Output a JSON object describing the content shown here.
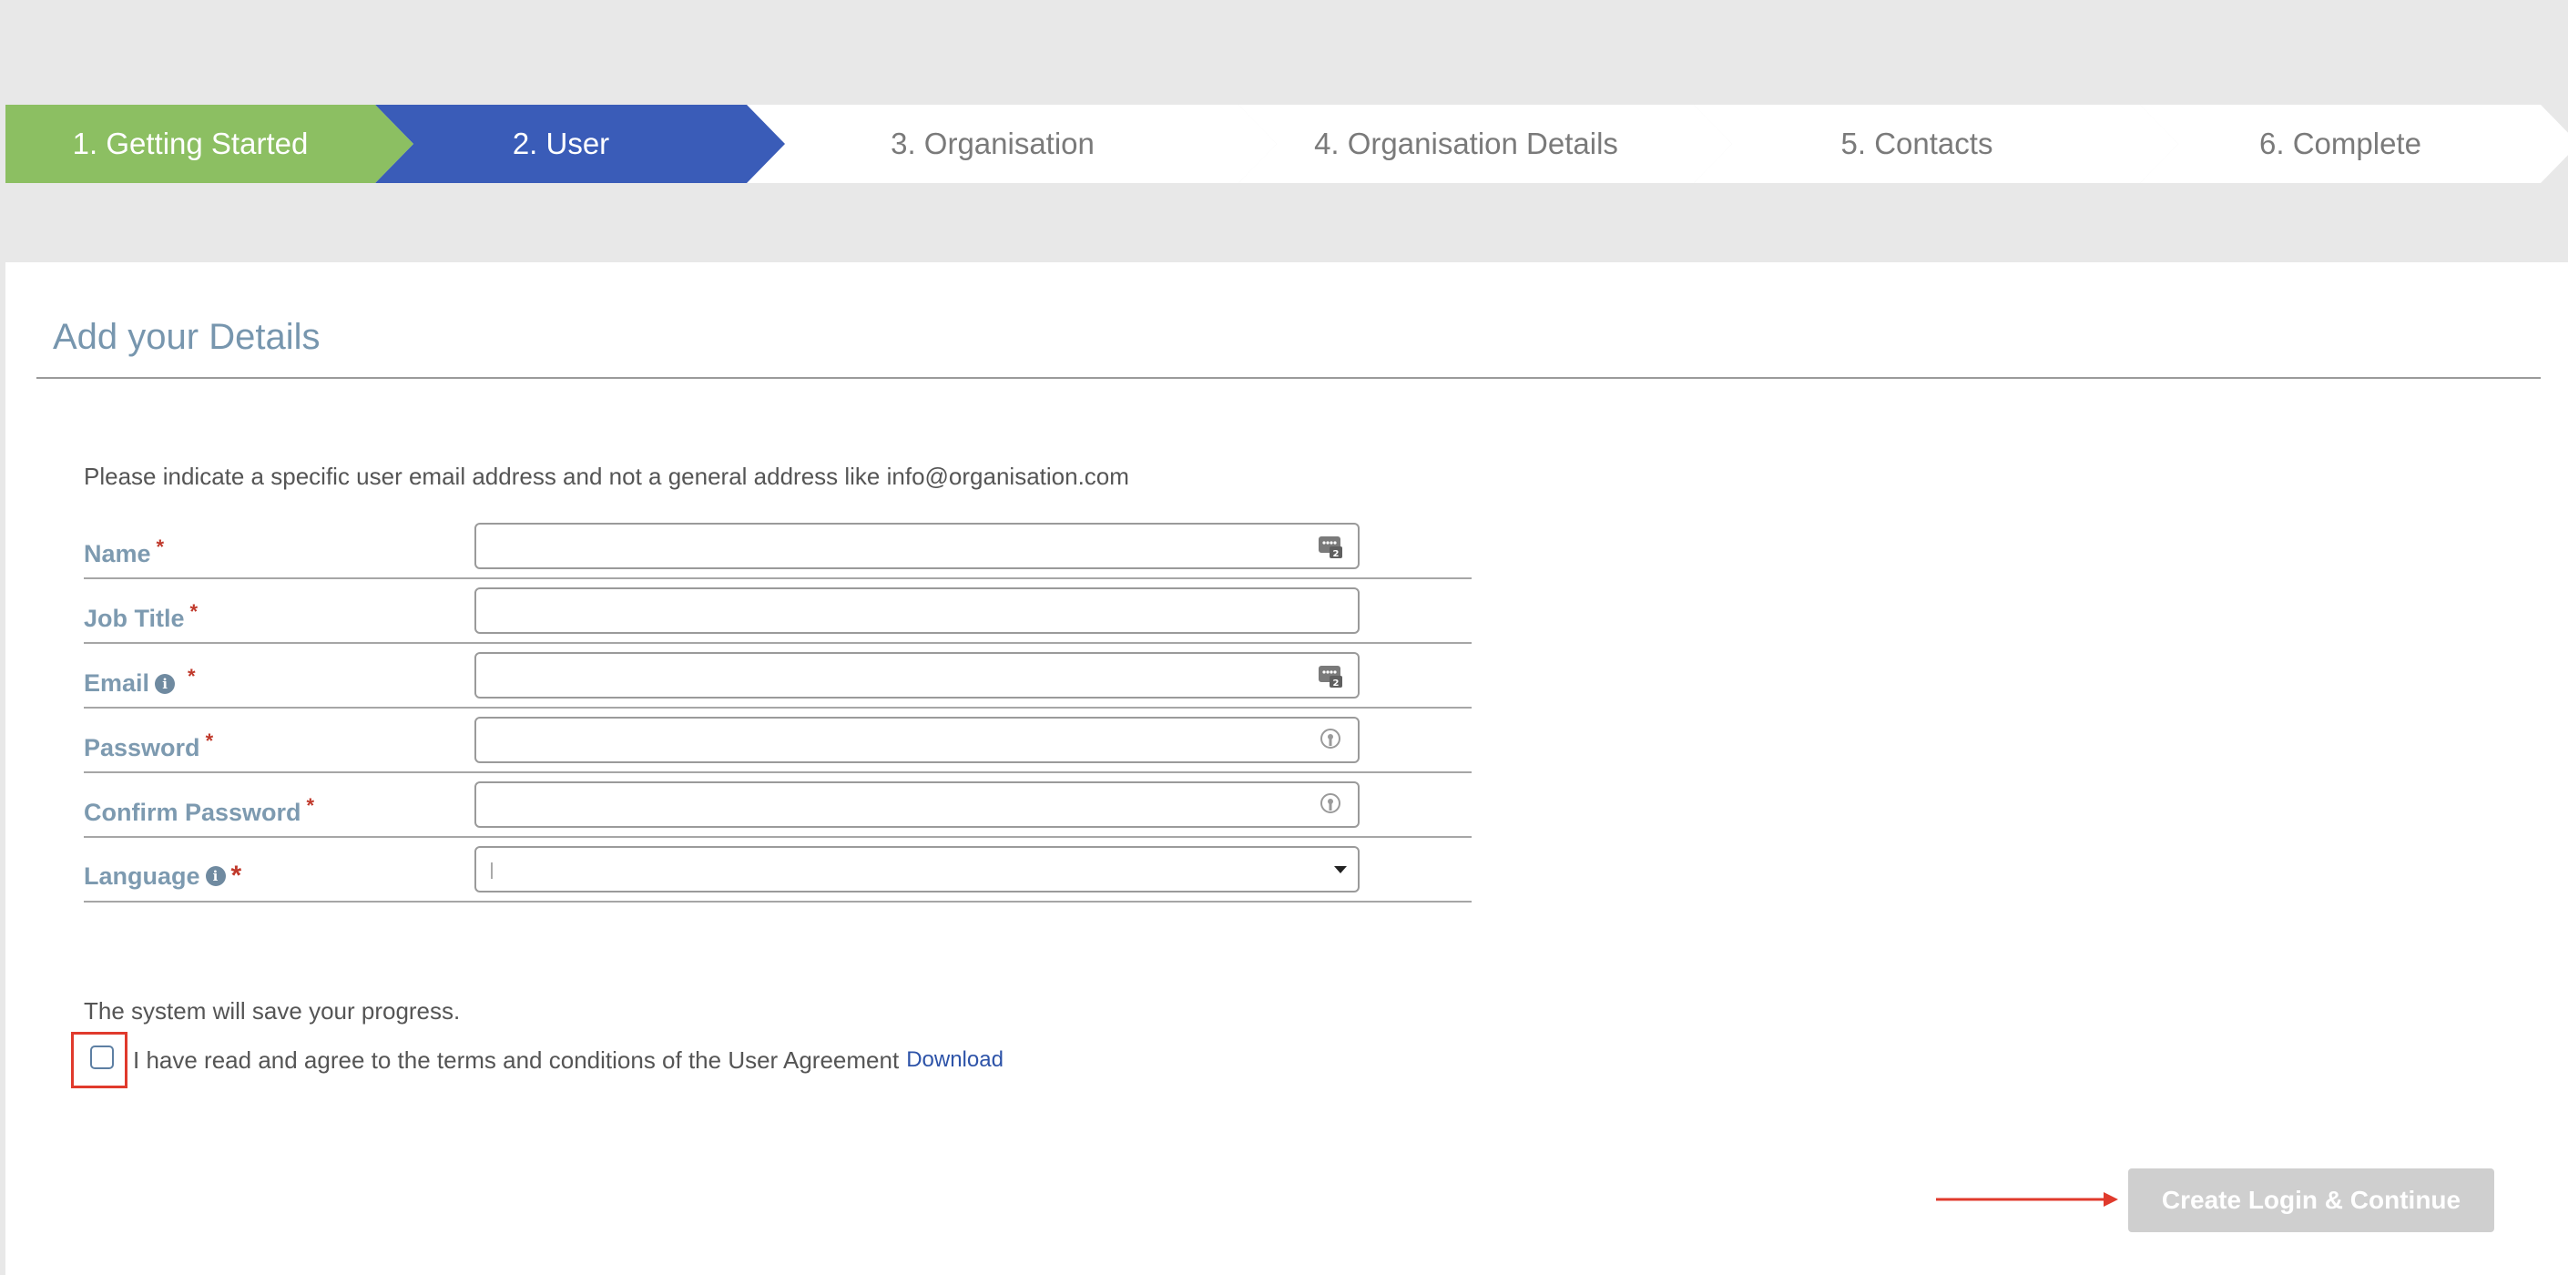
{
  "stepper": {
    "steps": [
      {
        "label": "1. Getting Started",
        "state": "done"
      },
      {
        "label": "2. User",
        "state": "active"
      },
      {
        "label": "3. Organisation",
        "state": "pending"
      },
      {
        "label": "4. Organisation Details",
        "state": "pending"
      },
      {
        "label": "5. Contacts",
        "state": "pending"
      },
      {
        "label": "6. Complete",
        "state": "pending"
      }
    ],
    "colors": {
      "done": "#8cbf62",
      "active": "#3a5cb8",
      "pending": "#ffffff"
    }
  },
  "form": {
    "title": "Add your Details",
    "intro": "Please indicate a specific user email address and not a general address like info@organisation.com",
    "fields": {
      "name": {
        "label": "Name",
        "required": "*",
        "value": "",
        "icon": "contact-card-icon"
      },
      "job_title": {
        "label": "Job Title",
        "required": "*",
        "value": ""
      },
      "email": {
        "label": "Email",
        "required": "*",
        "value": "",
        "icon": "contact-card-icon",
        "info_icon": "i"
      },
      "password": {
        "label": "Password",
        "required": "*",
        "value": "",
        "icon": "password-key-icon"
      },
      "confirm_password": {
        "label": "Confirm Password",
        "required": "*",
        "value": "",
        "icon": "password-key-icon"
      },
      "language": {
        "label": "Language",
        "required": "*",
        "value": "",
        "info_icon": "i"
      }
    },
    "save_note": "The system will save your progress.",
    "agreement": {
      "text": "I have read and agree to the terms and conditions of the User Agreement",
      "link": "Download",
      "checked": false
    },
    "submit_label": "Create Login & Continue"
  },
  "colors": {
    "label": "#7d9ab0",
    "required": "#c0392b",
    "highlight": "#e03a2c",
    "button_disabled": "#cfcfcf"
  }
}
